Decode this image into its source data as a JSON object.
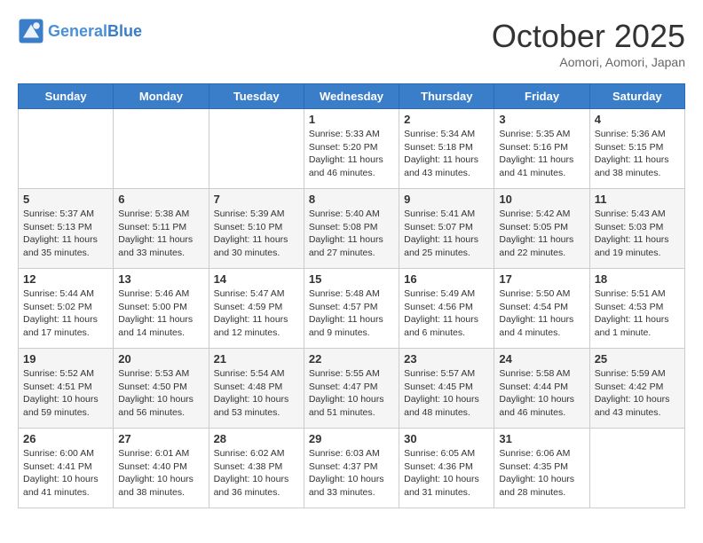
{
  "header": {
    "logo_general": "General",
    "logo_blue": "Blue",
    "month_title": "October 2025",
    "location": "Aomori, Aomori, Japan"
  },
  "days_of_week": [
    "Sunday",
    "Monday",
    "Tuesday",
    "Wednesday",
    "Thursday",
    "Friday",
    "Saturday"
  ],
  "weeks": [
    [
      {
        "day": "",
        "info": ""
      },
      {
        "day": "",
        "info": ""
      },
      {
        "day": "",
        "info": ""
      },
      {
        "day": "1",
        "info": "Sunrise: 5:33 AM\nSunset: 5:20 PM\nDaylight: 11 hours and 46 minutes."
      },
      {
        "day": "2",
        "info": "Sunrise: 5:34 AM\nSunset: 5:18 PM\nDaylight: 11 hours and 43 minutes."
      },
      {
        "day": "3",
        "info": "Sunrise: 5:35 AM\nSunset: 5:16 PM\nDaylight: 11 hours and 41 minutes."
      },
      {
        "day": "4",
        "info": "Sunrise: 5:36 AM\nSunset: 5:15 PM\nDaylight: 11 hours and 38 minutes."
      }
    ],
    [
      {
        "day": "5",
        "info": "Sunrise: 5:37 AM\nSunset: 5:13 PM\nDaylight: 11 hours and 35 minutes."
      },
      {
        "day": "6",
        "info": "Sunrise: 5:38 AM\nSunset: 5:11 PM\nDaylight: 11 hours and 33 minutes."
      },
      {
        "day": "7",
        "info": "Sunrise: 5:39 AM\nSunset: 5:10 PM\nDaylight: 11 hours and 30 minutes."
      },
      {
        "day": "8",
        "info": "Sunrise: 5:40 AM\nSunset: 5:08 PM\nDaylight: 11 hours and 27 minutes."
      },
      {
        "day": "9",
        "info": "Sunrise: 5:41 AM\nSunset: 5:07 PM\nDaylight: 11 hours and 25 minutes."
      },
      {
        "day": "10",
        "info": "Sunrise: 5:42 AM\nSunset: 5:05 PM\nDaylight: 11 hours and 22 minutes."
      },
      {
        "day": "11",
        "info": "Sunrise: 5:43 AM\nSunset: 5:03 PM\nDaylight: 11 hours and 19 minutes."
      }
    ],
    [
      {
        "day": "12",
        "info": "Sunrise: 5:44 AM\nSunset: 5:02 PM\nDaylight: 11 hours and 17 minutes."
      },
      {
        "day": "13",
        "info": "Sunrise: 5:46 AM\nSunset: 5:00 PM\nDaylight: 11 hours and 14 minutes."
      },
      {
        "day": "14",
        "info": "Sunrise: 5:47 AM\nSunset: 4:59 PM\nDaylight: 11 hours and 12 minutes."
      },
      {
        "day": "15",
        "info": "Sunrise: 5:48 AM\nSunset: 4:57 PM\nDaylight: 11 hours and 9 minutes."
      },
      {
        "day": "16",
        "info": "Sunrise: 5:49 AM\nSunset: 4:56 PM\nDaylight: 11 hours and 6 minutes."
      },
      {
        "day": "17",
        "info": "Sunrise: 5:50 AM\nSunset: 4:54 PM\nDaylight: 11 hours and 4 minutes."
      },
      {
        "day": "18",
        "info": "Sunrise: 5:51 AM\nSunset: 4:53 PM\nDaylight: 11 hours and 1 minute."
      }
    ],
    [
      {
        "day": "19",
        "info": "Sunrise: 5:52 AM\nSunset: 4:51 PM\nDaylight: 10 hours and 59 minutes."
      },
      {
        "day": "20",
        "info": "Sunrise: 5:53 AM\nSunset: 4:50 PM\nDaylight: 10 hours and 56 minutes."
      },
      {
        "day": "21",
        "info": "Sunrise: 5:54 AM\nSunset: 4:48 PM\nDaylight: 10 hours and 53 minutes."
      },
      {
        "day": "22",
        "info": "Sunrise: 5:55 AM\nSunset: 4:47 PM\nDaylight: 10 hours and 51 minutes."
      },
      {
        "day": "23",
        "info": "Sunrise: 5:57 AM\nSunset: 4:45 PM\nDaylight: 10 hours and 48 minutes."
      },
      {
        "day": "24",
        "info": "Sunrise: 5:58 AM\nSunset: 4:44 PM\nDaylight: 10 hours and 46 minutes."
      },
      {
        "day": "25",
        "info": "Sunrise: 5:59 AM\nSunset: 4:42 PM\nDaylight: 10 hours and 43 minutes."
      }
    ],
    [
      {
        "day": "26",
        "info": "Sunrise: 6:00 AM\nSunset: 4:41 PM\nDaylight: 10 hours and 41 minutes."
      },
      {
        "day": "27",
        "info": "Sunrise: 6:01 AM\nSunset: 4:40 PM\nDaylight: 10 hours and 38 minutes."
      },
      {
        "day": "28",
        "info": "Sunrise: 6:02 AM\nSunset: 4:38 PM\nDaylight: 10 hours and 36 minutes."
      },
      {
        "day": "29",
        "info": "Sunrise: 6:03 AM\nSunset: 4:37 PM\nDaylight: 10 hours and 33 minutes."
      },
      {
        "day": "30",
        "info": "Sunrise: 6:05 AM\nSunset: 4:36 PM\nDaylight: 10 hours and 31 minutes."
      },
      {
        "day": "31",
        "info": "Sunrise: 6:06 AM\nSunset: 4:35 PM\nDaylight: 10 hours and 28 minutes."
      },
      {
        "day": "",
        "info": ""
      }
    ]
  ]
}
